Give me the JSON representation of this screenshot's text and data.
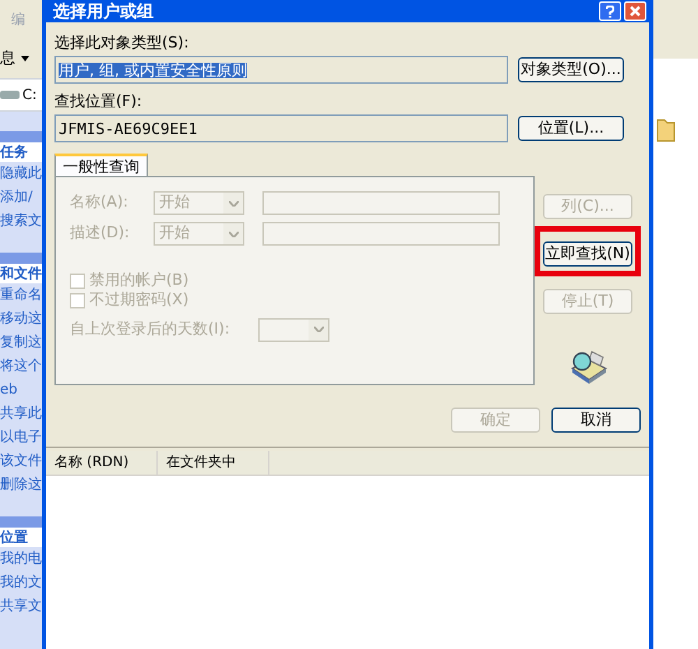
{
  "background_window": {
    "left_panel": [
      {
        "kind": "toolbar",
        "text": "编"
      },
      {
        "kind": "menu",
        "text": "息"
      },
      {
        "kind": "drive",
        "text": "C:"
      },
      {
        "kind": "section",
        "text": "任务"
      },
      {
        "kind": "link",
        "text": "隐藏此"
      },
      {
        "kind": "link",
        "text": "添加/"
      },
      {
        "kind": "link",
        "text": "搜索文"
      },
      {
        "kind": "section",
        "text": "和文件"
      },
      {
        "kind": "link",
        "text": "重命名"
      },
      {
        "kind": "link",
        "text": "移动这"
      },
      {
        "kind": "link",
        "text": "复制这"
      },
      {
        "kind": "link",
        "text": "将这个"
      },
      {
        "kind": "link",
        "text": "eb"
      },
      {
        "kind": "link",
        "text": "共享此"
      },
      {
        "kind": "link",
        "text": "以电子"
      },
      {
        "kind": "link",
        "text": "该文件"
      },
      {
        "kind": "link",
        "text": "删除这"
      },
      {
        "kind": "section",
        "text": "位置"
      },
      {
        "kind": "link",
        "text": "我的电"
      },
      {
        "kind": "link",
        "text": "我的文"
      },
      {
        "kind": "link",
        "text": "共享文"
      }
    ]
  },
  "dialog": {
    "title": "选择用户或组",
    "object_type": {
      "label": "选择此对象类型(S):",
      "value": "用户, 组, 或内置安全性原则",
      "button": "对象类型(O)..."
    },
    "location": {
      "label": "查找位置(F):",
      "value": "JFMIS-AE69C9EE1",
      "button": "位置(L)..."
    },
    "tabs": [
      {
        "label": "一般性查询",
        "selected": true
      }
    ],
    "query": {
      "rows": [
        {
          "label": "名称(A):",
          "operator": "开始"
        },
        {
          "label": "描述(D):",
          "operator": "开始"
        }
      ],
      "checkboxes": [
        {
          "label": "禁用的帐户(B)",
          "checked": false
        },
        {
          "label": "不过期密码(X)",
          "checked": false
        }
      ],
      "days_label": "自上次登录后的天数(I):"
    },
    "side_buttons": [
      {
        "label": "列(C)...",
        "disabled": true,
        "highlighted": false
      },
      {
        "label": "立即查找(N)",
        "disabled": false,
        "highlighted": true
      },
      {
        "label": "停止(T)",
        "disabled": true,
        "highlighted": false
      }
    ],
    "ok_button": {
      "label": "确定",
      "disabled": true
    },
    "cancel_button": {
      "label": "取消",
      "disabled": false
    },
    "results": {
      "columns": [
        "名称 (RDN)",
        "在文件夹中"
      ]
    }
  }
}
